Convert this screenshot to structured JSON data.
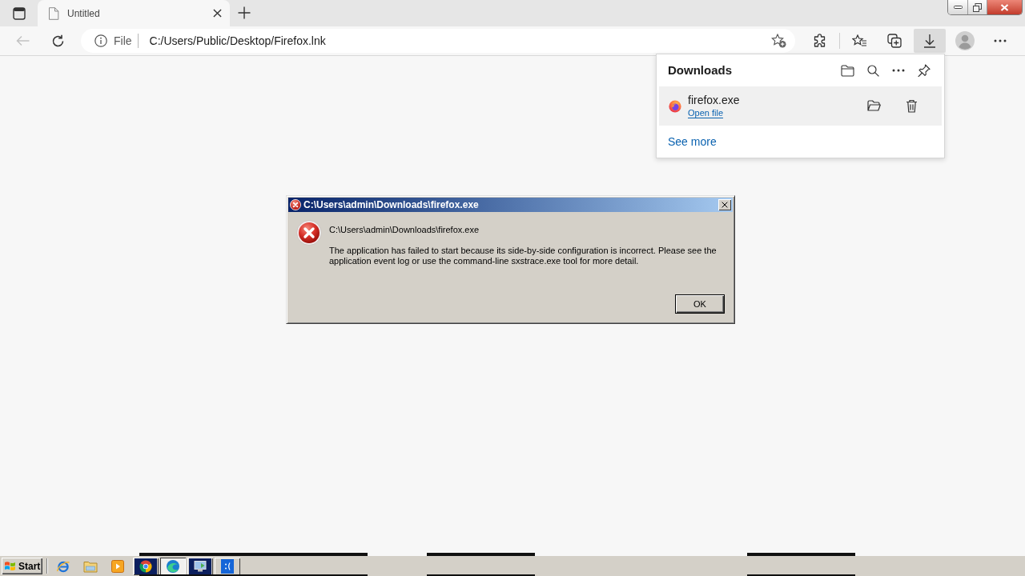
{
  "browser": {
    "tabs": [
      {
        "title": "Untitled",
        "selected": true
      }
    ],
    "back_button": {
      "disabled": true
    },
    "address_bar": {
      "scheme": "File",
      "url": "C:/Users/Public/Desktop/Firefox.lnk"
    },
    "toolbar_buttons": [
      {
        "kind": "extensions",
        "selected": false
      },
      {
        "kind": "favorites",
        "selected": false
      },
      {
        "kind": "collections",
        "selected": false
      },
      {
        "kind": "downloads",
        "selected": true
      },
      {
        "kind": "profile",
        "selected": false
      },
      {
        "kind": "more",
        "selected": false
      }
    ]
  },
  "downloads_panel": {
    "title": "Downloads",
    "items": [
      {
        "file_name": "firefox.exe",
        "link": "Open file"
      }
    ],
    "see_more": "See more"
  },
  "dialog": {
    "title": "C:\\Users\\admin\\Downloads\\firefox.exe",
    "path": "C:\\Users\\admin\\Downloads\\firefox.exe",
    "message": "The application has failed to start because its side-by-side configuration is incorrect. Please see the application event log or use the command-line sxstrace.exe tool for more detail.",
    "buttons": [
      "OK"
    ]
  },
  "taskbar": {
    "start": "Start",
    "quick_launch": [
      {
        "kind": "ie"
      },
      {
        "kind": "explorer"
      },
      {
        "kind": "media"
      }
    ],
    "tasks": [
      {
        "kind": "chrome",
        "selected": false
      },
      {
        "kind": "edge",
        "selected": true
      },
      {
        "kind": "monitor",
        "selected": false
      },
      {
        "kind": "sadface",
        "selected": false
      }
    ]
  }
}
